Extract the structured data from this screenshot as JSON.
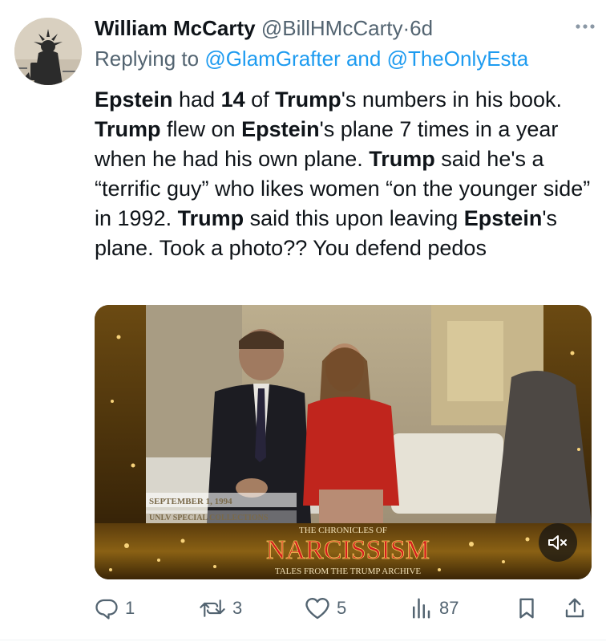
{
  "author": {
    "name": "William McCarty",
    "handle": "@BillHMcCarty",
    "separator": "·",
    "time": "6d"
  },
  "reply": {
    "prefix": "Replying to ",
    "mention1": "@GlamGrafter",
    "conjunction": " and ",
    "mention2": "@TheOnlyEsta"
  },
  "tweet": {
    "segments": [
      {
        "text": "Epstein",
        "bold": true
      },
      {
        "text": " had ",
        "bold": false
      },
      {
        "text": "14",
        "bold": true
      },
      {
        "text": " of ",
        "bold": false
      },
      {
        "text": "Trump",
        "bold": true
      },
      {
        "text": "'s numbers in his book. ",
        "bold": false
      },
      {
        "text": "Trump",
        "bold": true
      },
      {
        "text": " flew on ",
        "bold": false
      },
      {
        "text": "Epstein",
        "bold": true
      },
      {
        "text": "'s plane 7 times in a year when he had his own plane. ",
        "bold": false
      },
      {
        "text": "Trump",
        "bold": true
      },
      {
        "text": " said he's a “terrific guy” who likes women “on the younger side” in 1992. ",
        "bold": false
      },
      {
        "text": "Trump",
        "bold": true
      },
      {
        "text": " said this upon leaving ",
        "bold": false
      },
      {
        "text": "Epstein",
        "bold": true
      },
      {
        "text": "'s plane. Took a photo?? You defend pedos",
        "bold": false
      }
    ]
  },
  "media": {
    "date_caption": "SEPTEMBER 1, 1994",
    "source_caption": "UNLV SPECIAL COLLECTIONS",
    "banner_top": "THE CHRONICLES OF",
    "banner_main": "NARCISSISM",
    "banner_sub": "TALES FROM THE TRUMP ARCHIVE",
    "mute_icon": "volume-muted-icon"
  },
  "actions": {
    "replies": "1",
    "reposts": "3",
    "likes": "5",
    "views": "87"
  },
  "colors": {
    "text": "#0f1419",
    "secondary": "#536471",
    "link": "#1d9bf0"
  }
}
